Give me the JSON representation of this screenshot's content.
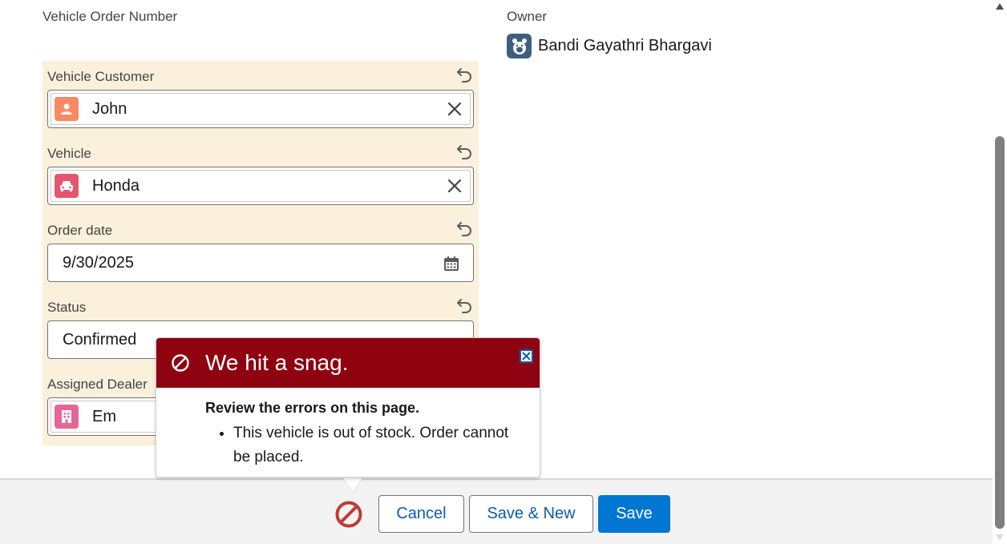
{
  "form": {
    "order_number_label": "Vehicle Order Number",
    "owner_label": "Owner",
    "owner_name": "Bandi Gayathri Bhargavi",
    "customer_label": "Vehicle Customer",
    "customer_value": "John",
    "vehicle_label": "Vehicle",
    "vehicle_value": "Honda",
    "order_date_label": "Order date",
    "order_date_value": "9/30/2025",
    "status_label": "Status",
    "status_value": "Confirmed",
    "dealer_label": "Assigned Dealer",
    "dealer_value": "Em"
  },
  "error_popover": {
    "title": "We hit a snag.",
    "subtitle": "Review the errors on this page.",
    "errors": [
      "This vehicle is out of stock. Order cannot be placed."
    ]
  },
  "footer": {
    "cancel_label": "Cancel",
    "save_new_label": "Save & New",
    "save_label": "Save"
  },
  "colors": {
    "edited_bg": "#faf0dc",
    "error_red": "#8e030f",
    "brand_blue": "#0176d3",
    "contact_icon": "#f88962",
    "vehicle_icon": "#e3566e",
    "dealer_icon": "#e56798"
  },
  "icons": [
    "owner-avatar-icon",
    "contact-icon",
    "car-icon",
    "building-icon",
    "calendar-icon",
    "undo-icon",
    "clear-icon",
    "error-ban-icon",
    "close-icon"
  ]
}
